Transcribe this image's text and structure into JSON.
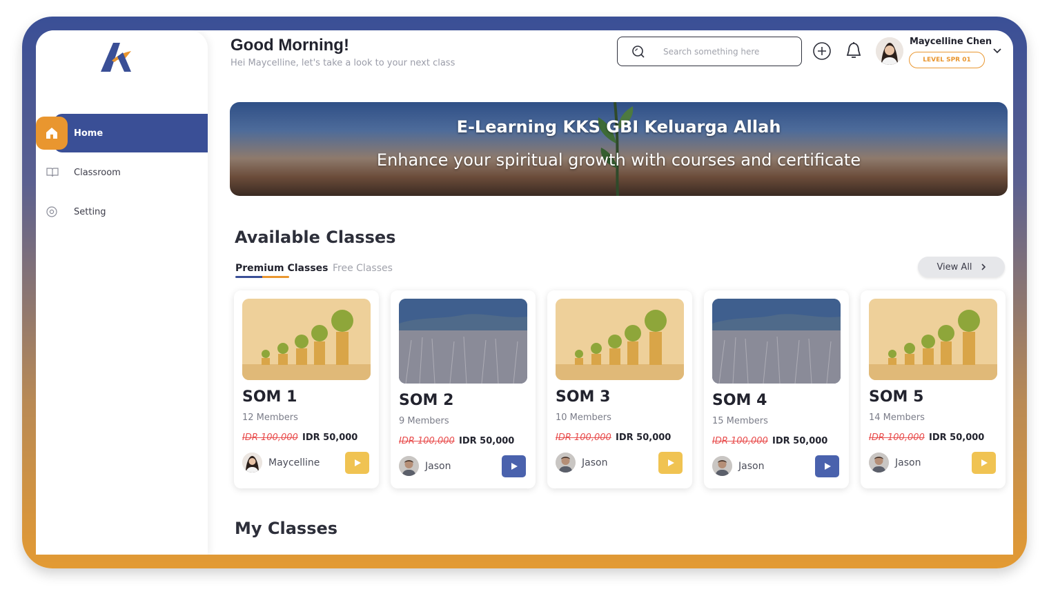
{
  "sidebar": {
    "items": [
      {
        "label": "Home",
        "icon": "home-icon",
        "active": true
      },
      {
        "label": "Classroom",
        "icon": "book-icon",
        "active": false
      },
      {
        "label": "Setting",
        "icon": "gear-icon",
        "active": false
      }
    ]
  },
  "header": {
    "greeting": "Good Morning!",
    "subtitle": "Hei Maycelline, let's take a look to your next class",
    "search_placeholder": "Search something here",
    "user_name": "Maycelline Chen",
    "user_level": "LEVEL SPR 01"
  },
  "banner": {
    "title": "E-Learning KKS GBI Keluarga Allah",
    "subtitle": "Enhance your spiritual growth with courses and certificate"
  },
  "available": {
    "title": "Available Classes",
    "tabs": [
      {
        "label": "Premium Classes",
        "active": true
      },
      {
        "label": "Free Classes",
        "active": false
      }
    ],
    "view_all": "View All",
    "cards": [
      {
        "title": "SOM 1",
        "members": "12 Members",
        "old_price": "IDR 100,000",
        "price": "IDR 50,000",
        "author": "Maycelline",
        "thumb": "coins",
        "play_color": "#f0c352"
      },
      {
        "title": "SOM 2",
        "members": "9 Members",
        "old_price": "IDR 100,000",
        "price": "IDR 50,000",
        "author": "Jason",
        "thumb": "field",
        "play_color": "#4a62ad"
      },
      {
        "title": "SOM 3",
        "members": "10 Members",
        "old_price": "IDR 100,000",
        "price": "IDR 50,000",
        "author": "Jason",
        "thumb": "coins",
        "play_color": "#f0c352"
      },
      {
        "title": "SOM 4",
        "members": "15 Members",
        "old_price": "IDR 100,000",
        "price": "IDR 50,000",
        "author": "Jason",
        "thumb": "field",
        "play_color": "#4a62ad"
      },
      {
        "title": "SOM 5",
        "members": "14 Members",
        "old_price": "IDR 100,000",
        "price": "IDR 50,000",
        "author": "Jason",
        "thumb": "coins",
        "play_color": "#f0c352"
      }
    ]
  },
  "my_classes": {
    "title": "My Classes"
  },
  "colors": {
    "primary": "#3a4f96",
    "accent": "#e9962f",
    "price_strike": "#e84c4c"
  }
}
